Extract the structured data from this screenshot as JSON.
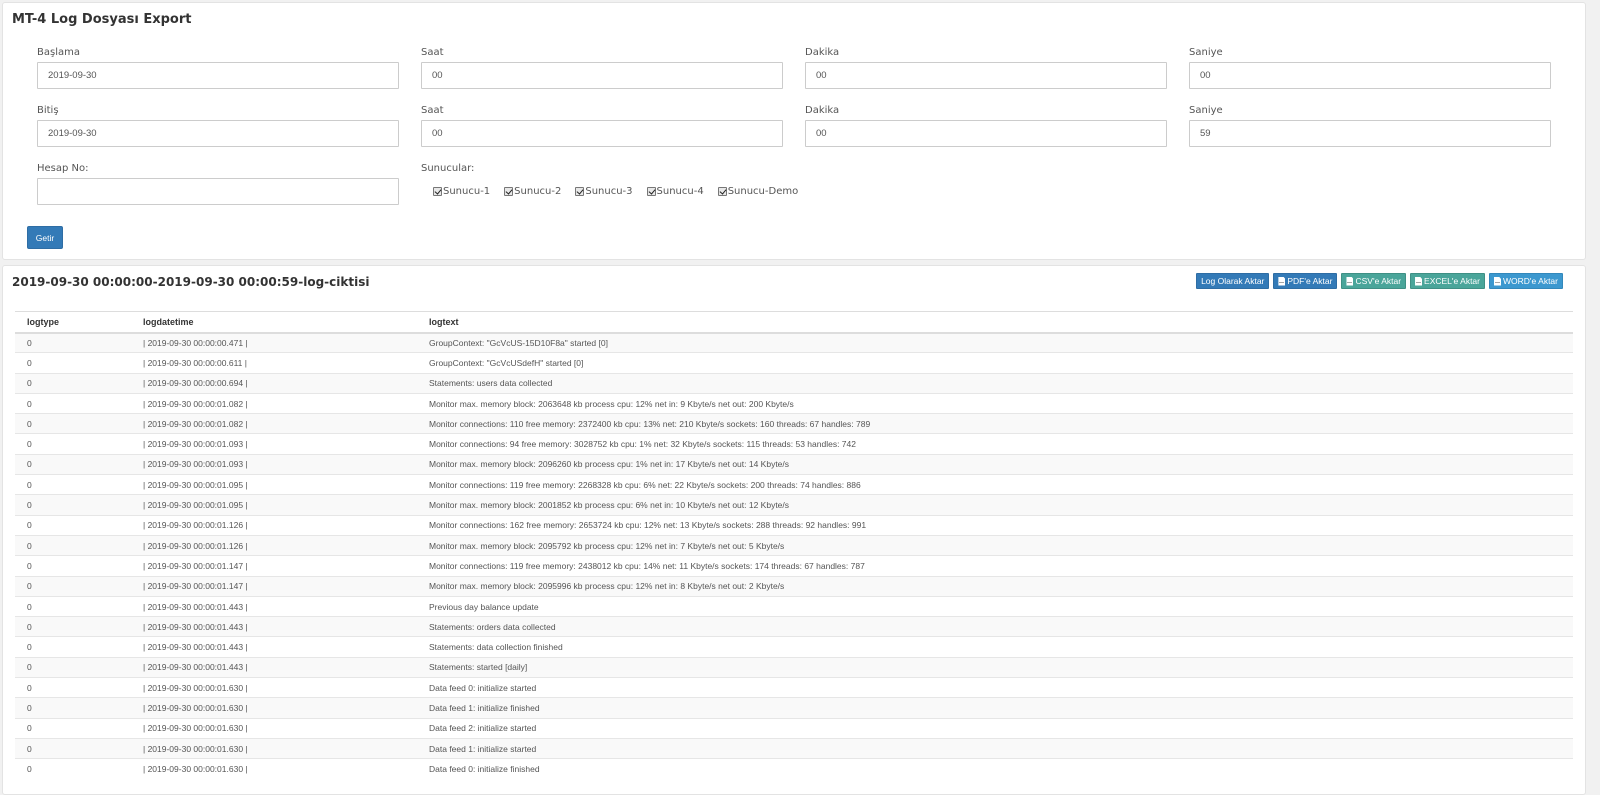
{
  "filter": {
    "title": "MT-4 Log Dosyası Export",
    "start": {
      "date_label": "Başlama",
      "date_value": "2019-09-30",
      "hour_label": "Saat",
      "hour_value": "00",
      "minute_label": "Dakika",
      "minute_value": "00",
      "second_label": "Saniye",
      "second_value": "00"
    },
    "end": {
      "date_label": "Bitiş",
      "date_value": "2019-09-30",
      "hour_label": "Saat",
      "hour_value": "00",
      "minute_label": "Dakika",
      "minute_value": "00",
      "second_label": "Saniye",
      "second_value": "59"
    },
    "account_label": "Hesap No:",
    "account_value": "",
    "servers_label": "Sunucular:",
    "servers": [
      "Sunucu-1",
      "Sunucu-2",
      "Sunucu-3",
      "Sunucu-4",
      "Sunucu-Demo"
    ],
    "submit_label": "Getir"
  },
  "result": {
    "title": "2019-09-30 00:00:00-2019-09-30 00:00:59-log-ciktisi",
    "exports": {
      "log": "Log Olarak Aktar",
      "pdf": "PDF'e Aktar",
      "csv": "CSV'e Aktar",
      "excel": "EXCEL'e Aktar",
      "word": "WORD'e Aktar"
    },
    "columns": [
      "logtype",
      "logdatetime",
      "logtext"
    ],
    "rows": [
      [
        "0",
        "| 2019-09-30 00:00:00.471 |",
        "GroupContext: \"GcVcUS-15D10F8a\" started [0]"
      ],
      [
        "0",
        "| 2019-09-30 00:00:00.611 |",
        "GroupContext: \"GcVcUSdefH\" started [0]"
      ],
      [
        "0",
        "| 2019-09-30 00:00:00.694 |",
        "Statements: users data collected"
      ],
      [
        "0",
        "| 2019-09-30 00:00:01.082 |",
        "Monitor max. memory block: 2063648 kb process cpu: 12% net in: 9 Kbyte/s net out: 200 Kbyte/s"
      ],
      [
        "0",
        "| 2019-09-30 00:00:01.082 |",
        "Monitor connections: 110 free memory: 2372400 kb cpu: 13% net: 210 Kbyte/s sockets: 160 threads: 67 handles: 789"
      ],
      [
        "0",
        "| 2019-09-30 00:00:01.093 |",
        "Monitor connections: 94 free memory: 3028752 kb cpu: 1% net: 32 Kbyte/s sockets: 115 threads: 53 handles: 742"
      ],
      [
        "0",
        "| 2019-09-30 00:00:01.093 |",
        "Monitor max. memory block: 2096260 kb process cpu: 1% net in: 17 Kbyte/s net out: 14 Kbyte/s"
      ],
      [
        "0",
        "| 2019-09-30 00:00:01.095 |",
        "Monitor connections: 119 free memory: 2268328 kb cpu: 6% net: 22 Kbyte/s sockets: 200 threads: 74 handles: 886"
      ],
      [
        "0",
        "| 2019-09-30 00:00:01.095 |",
        "Monitor max. memory block: 2001852 kb process cpu: 6% net in: 10 Kbyte/s net out: 12 Kbyte/s"
      ],
      [
        "0",
        "| 2019-09-30 00:00:01.126 |",
        "Monitor connections: 162 free memory: 2653724 kb cpu: 12% net: 13 Kbyte/s sockets: 288 threads: 92 handles: 991"
      ],
      [
        "0",
        "| 2019-09-30 00:00:01.126 |",
        "Monitor max. memory block: 2095792 kb process cpu: 12% net in: 7 Kbyte/s net out: 5 Kbyte/s"
      ],
      [
        "0",
        "| 2019-09-30 00:00:01.147 |",
        "Monitor connections: 119 free memory: 2438012 kb cpu: 14% net: 11 Kbyte/s sockets: 174 threads: 67 handles: 787"
      ],
      [
        "0",
        "| 2019-09-30 00:00:01.147 |",
        "Monitor max. memory block: 2095996 kb process cpu: 12% net in: 8 Kbyte/s net out: 2 Kbyte/s"
      ],
      [
        "0",
        "| 2019-09-30 00:00:01.443 |",
        "Previous day balance update"
      ],
      [
        "0",
        "| 2019-09-30 00:00:01.443 |",
        "Statements: orders data collected"
      ],
      [
        "0",
        "| 2019-09-30 00:00:01.443 |",
        "Statements: data collection finished"
      ],
      [
        "0",
        "| 2019-09-30 00:00:01.443 |",
        "Statements: started [daily]"
      ],
      [
        "0",
        "| 2019-09-30 00:00:01.630 |",
        "Data feed 0: initialize started"
      ],
      [
        "0",
        "| 2019-09-30 00:00:01.630 |",
        "Data feed 1: initialize finished"
      ],
      [
        "0",
        "| 2019-09-30 00:00:01.630 |",
        "Data feed 2: initialize started"
      ],
      [
        "0",
        "| 2019-09-30 00:00:01.630 |",
        "Data feed 1: initialize started"
      ],
      [
        "0",
        "| 2019-09-30 00:00:01.630 |",
        "Data feed 0: initialize finished"
      ]
    ]
  }
}
